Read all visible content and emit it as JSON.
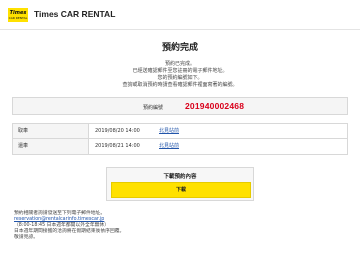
{
  "header": {
    "logo_line1": "Times",
    "logo_line2": "CAR RENTAL",
    "brand_name": "Times CAR RENTAL",
    "accent_color": "#ffe100"
  },
  "page": {
    "title": "預約完成"
  },
  "intro_lines": [
    "預約已完成。",
    "已經送確認郵件至您註冊的電子郵件地址。",
    "您的預約編號如下。",
    "查詢或取消預約時請查看確認郵件裡面寫著的編號。"
  ],
  "reservation": {
    "label": "預約編號",
    "number": "201940002468",
    "number_color": "#d9001b"
  },
  "details": [
    {
      "label": "取車",
      "datetime": "2019/08/20 14:00",
      "store": "北見站前"
    },
    {
      "label": "還車",
      "datetime": "2019/08/21 14:00",
      "store": "北見站前"
    }
  ],
  "download": {
    "title": "下載預約內容",
    "button_label": "下載"
  },
  "footer": {
    "lines": [
      "預約相關者詢請發送至下列電子郵件地址。",
      "reservation@rentalcarinfo.timescar.jp",
      "（8:00-18:45 日本週年都開以外全年無休）",
      "日本週年期間接獲的洽詢將在假期結束後依序回覆。",
      "敬請見諒。"
    ]
  }
}
